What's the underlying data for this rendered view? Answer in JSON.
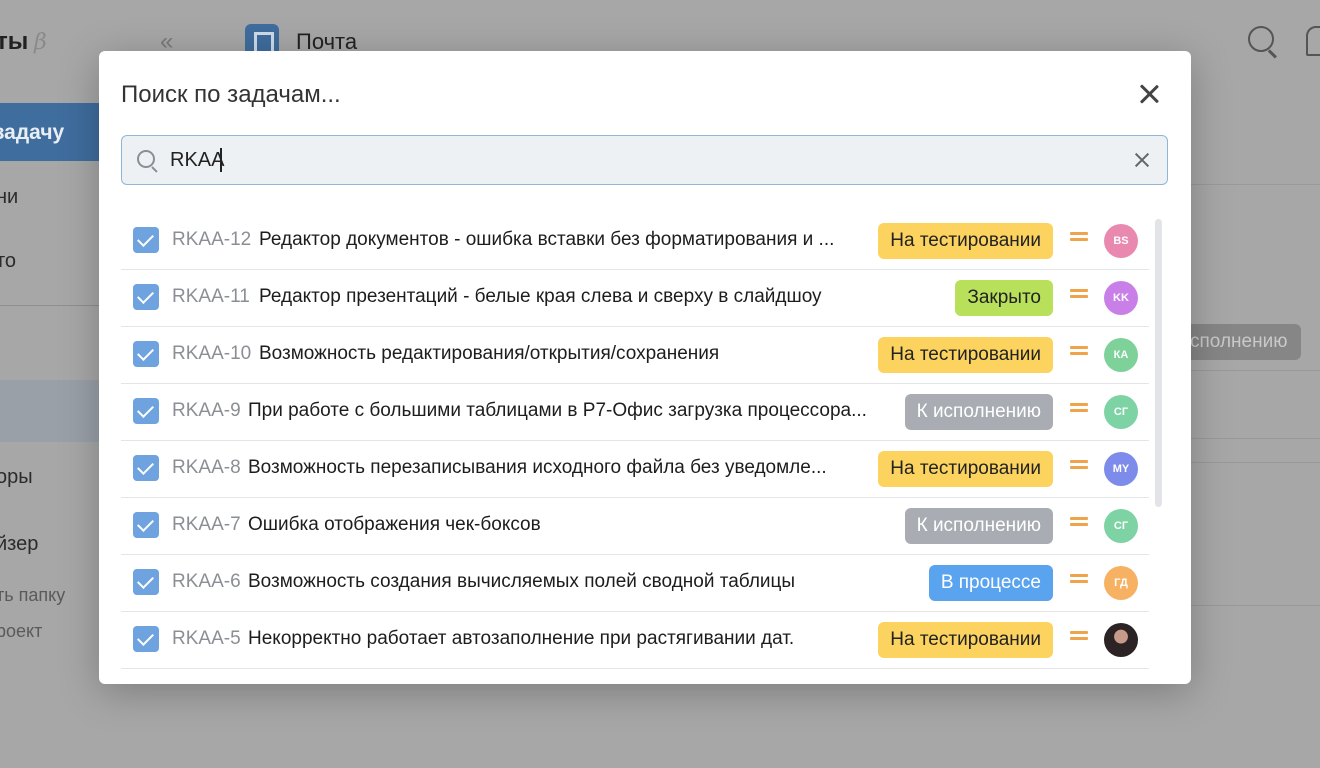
{
  "background": {
    "brand": "ты",
    "beta": "β",
    "collapse": "«",
    "project_name": "Почта",
    "create_label": "задачу",
    "sidebar_items": [
      "ни",
      "то",
      "оры",
      "йзер",
      "ть папку",
      "роект"
    ],
    "background_badge": "сполнению"
  },
  "modal": {
    "title": "Поиск по задачам...",
    "search": {
      "value": "RKAA",
      "placeholder": ""
    }
  },
  "results": [
    {
      "key": "RKAA-12",
      "title": "Редактор документов - ошибка вставки без форматирования и ...",
      "status": "На тестировании",
      "status_color": "#fbd35e",
      "status_text_color": "#222222",
      "priority": "equal",
      "avatar": "BS",
      "avatar_color": "#ea89b0"
    },
    {
      "key": "RKAA-11",
      "title": "Редактор презентаций - белые края слева и сверху в слайдшоу",
      "status": "Закрыто",
      "status_color": "#b8e05a",
      "status_text_color": "#222222",
      "priority": "equal",
      "avatar": "KK",
      "avatar_color": "#c87fe8"
    },
    {
      "key": "RKAA-10",
      "title": "Возможность редактирования/открытия/сохранения",
      "status": "На тестировании",
      "status_color": "#fbd35e",
      "status_text_color": "#222222",
      "priority": "equal",
      "avatar": "КА",
      "avatar_color": "#7dd199"
    },
    {
      "key": "RKAA-9",
      "title": "При работе с большими таблицами в Р7-Офис загрузка процессора...",
      "status": "К исполнению",
      "status_color": "#a9adb3",
      "status_text_color": "#ffffff",
      "priority": "equal",
      "avatar": "СГ",
      "avatar_color": "#7dd3a4"
    },
    {
      "key": "RKAA-8",
      "title": "Возможность перезаписывания исходного файла без уведомле...",
      "status": "На тестировании",
      "status_color": "#fbd35e",
      "status_text_color": "#222222",
      "priority": "equal",
      "avatar": "MY",
      "avatar_color": "#7d8bea"
    },
    {
      "key": "RKAA-7",
      "title": "Ошибка отображения чек-боксов",
      "status": "К исполнению",
      "status_color": "#a9adb3",
      "status_text_color": "#ffffff",
      "priority": "equal",
      "avatar": "СГ",
      "avatar_color": "#7dd3a4"
    },
    {
      "key": "RKAA-6",
      "title": "Возможность создания вычисляемых полей сводной таблицы",
      "status": "В процессе",
      "status_color": "#5aa3ef",
      "status_text_color": "#ffffff",
      "priority": "equal",
      "avatar": "ГД",
      "avatar_color": "#f6b262"
    },
    {
      "key": "RKAA-5",
      "title": "Некорректно работает автозаполнение при растягивании дат.",
      "status": "На тестировании",
      "status_color": "#fbd35e",
      "status_text_color": "#222222",
      "priority": "equal",
      "avatar": "",
      "avatar_color": "photo"
    }
  ]
}
